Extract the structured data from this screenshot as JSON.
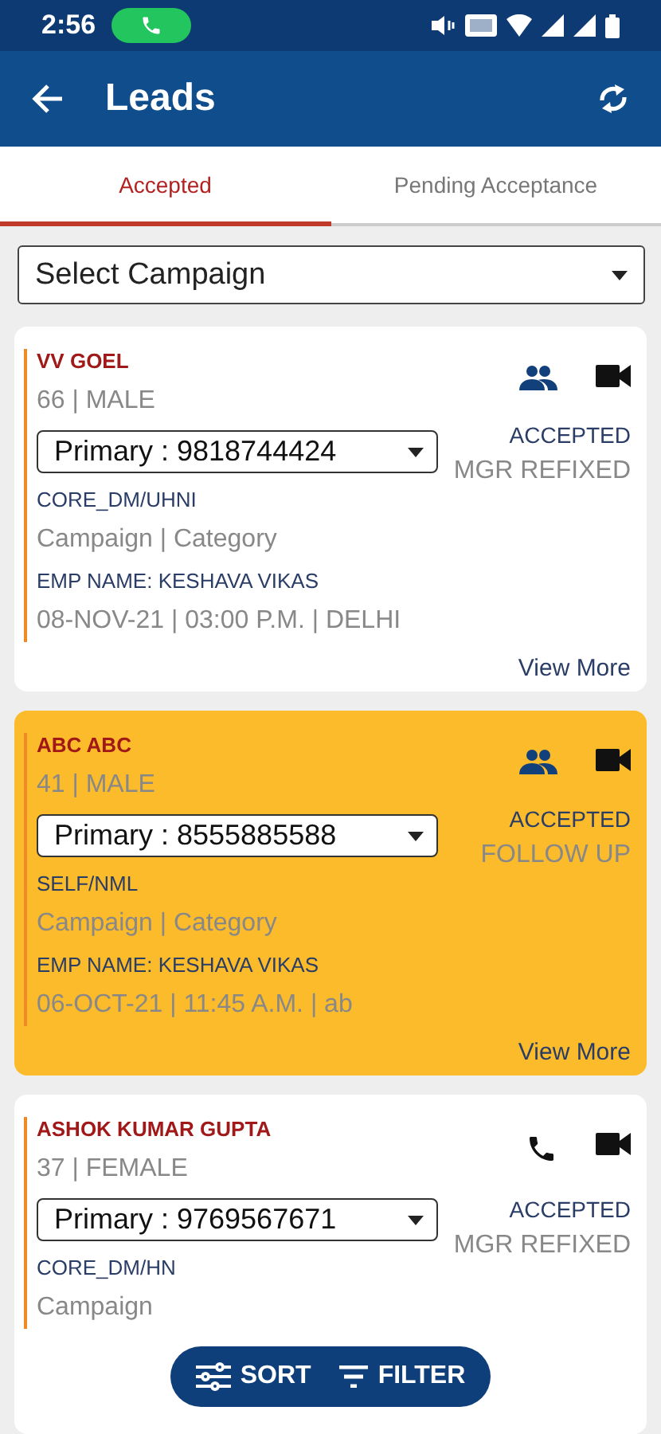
{
  "status_bar": {
    "time": "2:56"
  },
  "app_bar": {
    "title": "Leads"
  },
  "tabs": [
    {
      "label": "Accepted",
      "selected": true
    },
    {
      "label": "Pending Acceptance",
      "selected": false
    }
  ],
  "campaign_select": {
    "value": "Select Campaign"
  },
  "leads": [
    {
      "name": "VV GOEL",
      "age_gender": "66 | MALE",
      "phone": "Primary : 9818744424",
      "contact": {
        "kind": "group"
      },
      "status": "ACCEPTED",
      "sub_status": "MGR REFIXED",
      "channel": "CORE_DM/UHNI",
      "campaign": "Campaign | Category",
      "emp_name": "EMP NAME: KESHAVA VIKAS",
      "schedule": "08-NOV-21 | 03:00 P.M. | DELHI",
      "link": "View More",
      "highlighted": false
    },
    {
      "name": "ABC ABC",
      "age_gender": "41 | MALE",
      "phone": "Primary : 8555885588",
      "contact": {
        "kind": "group"
      },
      "status": "ACCEPTED",
      "sub_status": "FOLLOW UP",
      "channel": "SELF/NML",
      "campaign": "Campaign | Category",
      "emp_name": "EMP NAME: KESHAVA VIKAS",
      "schedule": "06-OCT-21 | 11:45 A.M. | ab",
      "link": "View More",
      "highlighted": true
    },
    {
      "name": "ASHOK KUMAR GUPTA",
      "age_gender": "37 | FEMALE",
      "phone": "Primary : 9769567671",
      "contact": {
        "kind": "phone"
      },
      "status": "ACCEPTED",
      "sub_status": "MGR REFIXED",
      "channel": "CORE_DM/HN",
      "campaign": "Campaign",
      "highlighted": false
    }
  ],
  "actions": [
    {
      "label": "SORT",
      "kind": "sort"
    },
    {
      "label": "FILTER",
      "kind": "filter"
    }
  ]
}
